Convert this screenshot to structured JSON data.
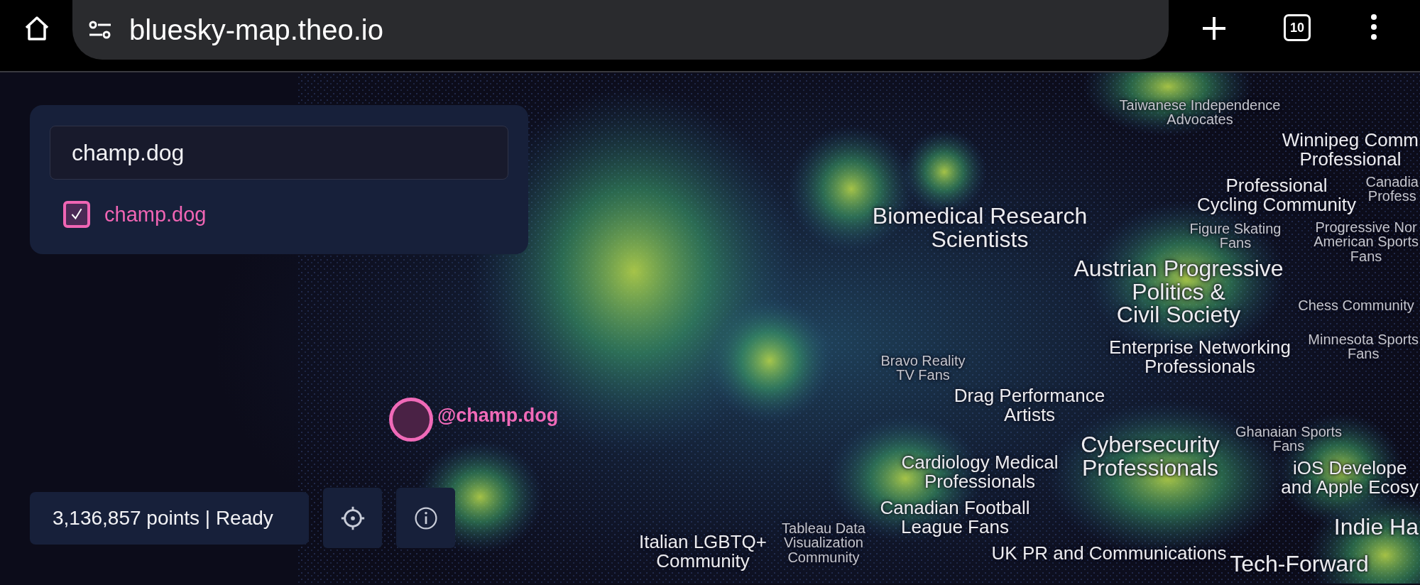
{
  "browser": {
    "url": "bluesky-map.theo.io",
    "tab_count": "10"
  },
  "search": {
    "value": "champ.dog",
    "results": [
      {
        "label": "champ.dog",
        "checked": true
      }
    ]
  },
  "highlight": {
    "label": "@champ.dog"
  },
  "map_labels": [
    {
      "lines": [
        "Taiwanese Independence",
        "Advocates"
      ],
      "kind": "minor"
    },
    {
      "lines": [
        "Winnipeg Comm",
        "Professional"
      ],
      "kind": "medium"
    },
    {
      "lines": [
        "Professional",
        "Cycling Community"
      ],
      "kind": "medium"
    },
    {
      "lines": [
        "Canadia",
        "Profess"
      ],
      "kind": "minor"
    },
    {
      "lines": [
        "Biomedical Research",
        "Scientists"
      ],
      "kind": "major"
    },
    {
      "lines": [
        "Figure Skating",
        "Fans"
      ],
      "kind": "minor"
    },
    {
      "lines": [
        "Progressive Nor",
        "American Sports",
        "Fans"
      ],
      "kind": "minor"
    },
    {
      "lines": [
        "Austrian Progressive",
        "Politics &",
        "Civil Society"
      ],
      "kind": "major"
    },
    {
      "lines": [
        "Chess Community"
      ],
      "kind": "minor"
    },
    {
      "lines": [
        "Enterprise Networking",
        "Professionals"
      ],
      "kind": "medium"
    },
    {
      "lines": [
        "Minnesota Sports",
        "Fans"
      ],
      "kind": "minor"
    },
    {
      "lines": [
        "Bravo Reality",
        "TV Fans"
      ],
      "kind": "minor"
    },
    {
      "lines": [
        "Drag Performance",
        "Artists"
      ],
      "kind": "medium"
    },
    {
      "lines": [
        "Ghanaian Sports",
        "Fans"
      ],
      "kind": "minor"
    },
    {
      "lines": [
        "Cybersecurity",
        "Professionals"
      ],
      "kind": "major"
    },
    {
      "lines": [
        "Cardiology Medical",
        "Professionals"
      ],
      "kind": "medium"
    },
    {
      "lines": [
        "iOS Develope",
        "and Apple Ecosy"
      ],
      "kind": "medium"
    },
    {
      "lines": [
        "Italian LGBTQ+",
        "Community"
      ],
      "kind": "medium"
    },
    {
      "lines": [
        "Tableau Data",
        "Visualization",
        "Community"
      ],
      "kind": "minor"
    },
    {
      "lines": [
        "Canadian Football",
        "League Fans"
      ],
      "kind": "medium"
    },
    {
      "lines": [
        "UK PR and Communications"
      ],
      "kind": "medium"
    },
    {
      "lines": [
        "Tech-Forward"
      ],
      "kind": "major"
    },
    {
      "lines": [
        "Indie Ha"
      ],
      "kind": "major"
    }
  ],
  "status": "3,136,857 points | Ready"
}
